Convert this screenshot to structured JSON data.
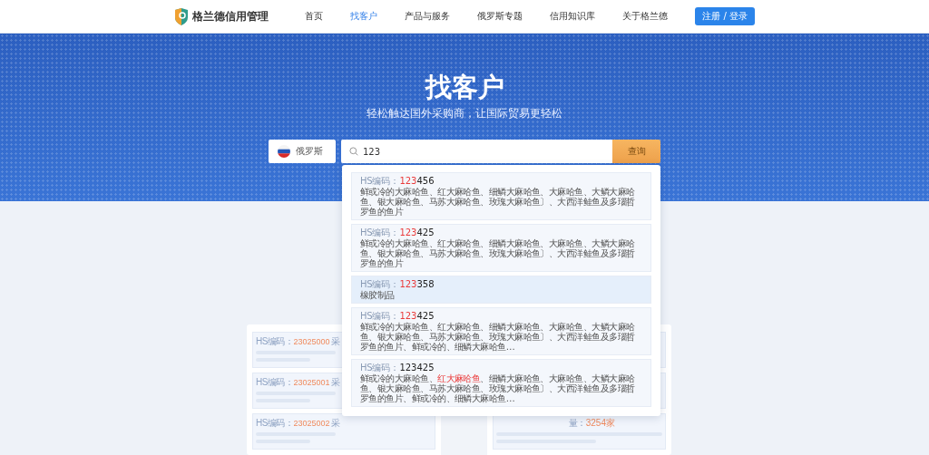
{
  "header": {
    "logo_text": "格兰德信用管理",
    "nav": [
      {
        "label": "首页",
        "selected": false
      },
      {
        "label": "找客户",
        "selected": true
      },
      {
        "label": "产品与服务",
        "selected": false
      },
      {
        "label": "俄罗斯专题",
        "selected": false
      },
      {
        "label": "信用知识库",
        "selected": false
      },
      {
        "label": "关于格兰德",
        "selected": false
      }
    ],
    "login_button": "注册 / 登录"
  },
  "hero": {
    "title": "找客户",
    "subtitle": "轻松触达国外采购商，让国际贸易更轻松"
  },
  "search": {
    "country": "俄罗斯",
    "query": "123",
    "button": "查询"
  },
  "suggestions": [
    {
      "selected": false,
      "label": "HS编码：",
      "code": [
        {
          "text": "123",
          "highlight": true
        },
        {
          "text": "456",
          "highlight": false
        }
      ],
      "description": [
        {
          "text": "鲜或冷的大麻哈鱼、红大麻哈鱼、细鳞大麻哈鱼、大麻哈鱼、大鳞大麻哈鱼、银大麻哈鱼、马苏大麻哈鱼、玫瑰大麻哈鱼〕、大西洋鲑鱼及多瑙哲罗鱼的鱼片",
          "highlight": false
        }
      ]
    },
    {
      "selected": false,
      "label": "HS编码：",
      "code": [
        {
          "text": "123",
          "highlight": true
        },
        {
          "text": "425",
          "highlight": false
        }
      ],
      "description": [
        {
          "text": "鲜或冷的大麻哈鱼、红大麻哈鱼、细鳞大麻哈鱼、大麻哈鱼、大鳞大麻哈鱼、银大麻哈鱼、马苏大麻哈鱼、玫瑰大麻哈鱼〕、大西洋鲑鱼及多瑙哲罗鱼的鱼片",
          "highlight": false
        }
      ]
    },
    {
      "selected": true,
      "label": "HS编码：",
      "code": [
        {
          "text": "123",
          "highlight": true
        },
        {
          "text": "358",
          "highlight": false
        }
      ],
      "description": [
        {
          "text": "橡胶制品",
          "highlight": false
        }
      ]
    },
    {
      "selected": false,
      "label": "HS编码：",
      "code": [
        {
          "text": "123",
          "highlight": true
        },
        {
          "text": "425",
          "highlight": false
        }
      ],
      "description": [
        {
          "text": "鲜或冷的大麻哈鱼、红大麻哈鱼、细鳞大麻哈鱼、大麻哈鱼、大鳞大麻哈鱼、银大麻哈鱼、马苏大麻哈鱼、玫瑰大麻哈鱼〕、大西洋鲑鱼及多瑙哲罗鱼的鱼片、鲜或冷的、细鳞大麻哈鱼…",
          "highlight": false
        }
      ]
    },
    {
      "selected": false,
      "label": "HS编码：",
      "code": [
        {
          "text": "123425",
          "highlight": false
        }
      ],
      "description": [
        {
          "text": "鲜或冷的大麻哈鱼、",
          "highlight": false
        },
        {
          "text": "红大麻哈鱼",
          "highlight": true
        },
        {
          "text": "、细鳞大麻哈鱼、大麻哈鱼、大鳞大麻哈鱼、银大麻哈鱼、马苏大麻哈鱼、玫瑰大麻哈鱼〕、大西洋鲑鱼及多瑙哲罗鱼的鱼片、鲜或冷的、细鳞大麻哈鱼…",
          "highlight": false
        }
      ]
    }
  ],
  "background_cards": {
    "left": [
      {
        "label": "HS编码：",
        "code": "23025000",
        "column_3": "采"
      },
      {
        "label": "HS编码：",
        "code": "23025001",
        "column_3": "采"
      },
      {
        "label": "HS编码：",
        "code": "23025002",
        "column_3": "采"
      }
    ],
    "right_quantity": {
      "label": "量：",
      "value": "3254家"
    }
  }
}
